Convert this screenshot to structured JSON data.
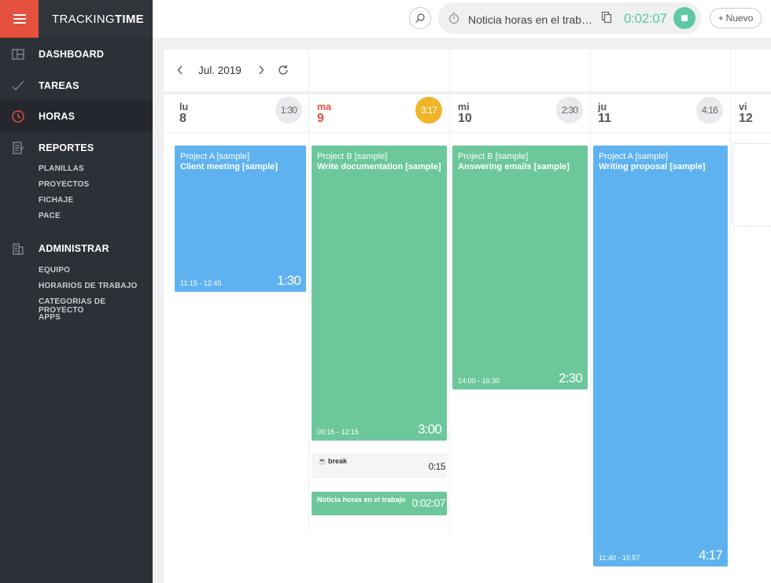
{
  "brand": {
    "part1": "TRACKING",
    "part2": "TIME"
  },
  "nav": {
    "dashboard": "DASHBOARD",
    "tareas": "TAREAS",
    "horas": "HORAS",
    "reportes": "REPORTES",
    "reportes_sub": [
      "PLANILLAS",
      "PROYECTOS",
      "FICHAJE",
      "PACE"
    ],
    "administrar": "ADMINISTRAR",
    "administrar_sub": [
      "EQUIPO",
      "HORARIOS DE TRABAJO",
      "CATEGORIAS DE PROYECTO",
      "APPS"
    ]
  },
  "topbar": {
    "timer_task": "Noticia horas en el trabajo",
    "timer_time": "0:02:07",
    "new_label": "Nuevo"
  },
  "calendar": {
    "month": "Jul. 2019",
    "days": [
      {
        "dow": "lu",
        "num": "8",
        "total": "1:30"
      },
      {
        "dow": "ma",
        "num": "9",
        "total": "3:17"
      },
      {
        "dow": "mi",
        "num": "10",
        "total": "2:30"
      },
      {
        "dow": "ju",
        "num": "11",
        "total": "4:16"
      },
      {
        "dow": "vi",
        "num": "12"
      }
    ],
    "entries": [
      {
        "project": "Project A [sample]",
        "task": "Client meeting [sample]",
        "range": "11:15 - 12:45",
        "duration": "1:30",
        "color": "#5fb2f0"
      },
      {
        "project": "Project B [sample]",
        "task": "Write documentation [sample]",
        "range": "09:15 - 12:15",
        "duration": "3:00",
        "color": "#6cc79a"
      },
      {
        "project": "Project B [sample]",
        "task": "Answering emails [sample]",
        "range": "14:00 - 16:30",
        "duration": "2:30",
        "color": "#6cc79a"
      },
      {
        "project": "Project A [sample]",
        "task": "Writing proposal [sample]",
        "range": "11:40 - 15:57",
        "duration": "4:17",
        "color": "#5fb2f0"
      }
    ],
    "break": {
      "label": "break",
      "duration": "0:15"
    },
    "running": {
      "label": "Noticia horas en el trabajo",
      "time": "0:02:07"
    }
  },
  "colors": {
    "accent": "#e5503f",
    "today_badge": "#f0b429",
    "green": "#6cc79a",
    "blue": "#5fb2f0",
    "sidebar": "#2c3138"
  }
}
